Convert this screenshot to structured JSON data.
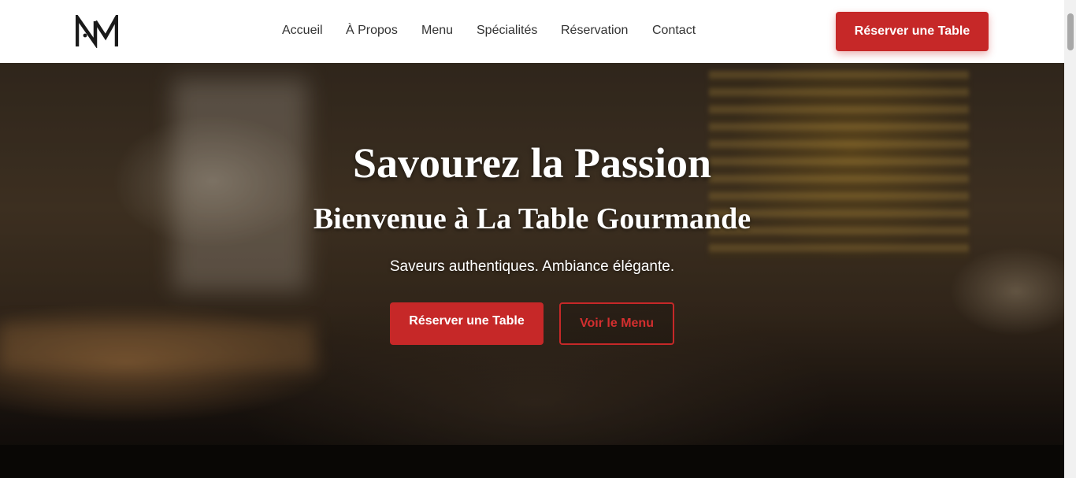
{
  "header": {
    "logo_label": "NM",
    "nav": [
      "Accueil",
      "À Propos",
      "Menu",
      "Spécialités",
      "Réservation",
      "Contact"
    ],
    "cta_label": "Réserver une Table"
  },
  "hero": {
    "title": "Savourez la Passion",
    "subtitle": "Bienvenue à La Table Gourmande",
    "tagline": "Saveurs authentiques. Ambiance élégante.",
    "primary_button": "Réserver une Table",
    "secondary_button": "Voir le Menu"
  },
  "colors": {
    "accent": "#c62828",
    "header_bg": "#ffffff",
    "nav_text": "#333333"
  },
  "icons": {
    "logo": "nm-monogram-logo"
  }
}
